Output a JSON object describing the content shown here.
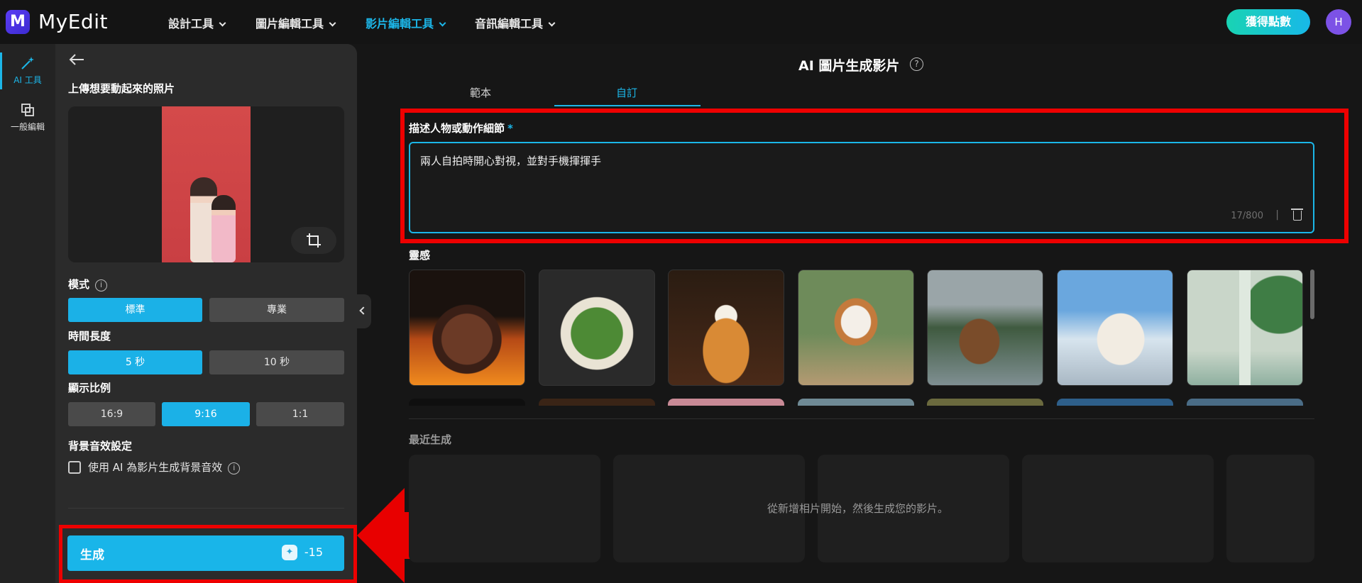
{
  "app": {
    "name": "MyEdit",
    "logo_letter": "M"
  },
  "nav": [
    {
      "label": "設計工具",
      "active": false
    },
    {
      "label": "圖片編輯工具",
      "active": false
    },
    {
      "label": "影片編輯工具",
      "active": true
    },
    {
      "label": "音訊編輯工具",
      "active": false
    }
  ],
  "header": {
    "points_button": "獲得點數",
    "avatar_initial": "H"
  },
  "rail": [
    {
      "label": "AI 工具",
      "icon": "magic-wand-icon",
      "active": true
    },
    {
      "label": "一般編輯",
      "icon": "layers-icon",
      "active": false
    }
  ],
  "panel": {
    "upload_title": "上傳想要動起來的照片",
    "mode": {
      "label": "模式",
      "options": [
        "標準",
        "專業"
      ],
      "selected": "標準"
    },
    "duration": {
      "label": "時間長度",
      "options": [
        "5 秒",
        "10 秒"
      ],
      "selected": "5 秒"
    },
    "ratio": {
      "label": "顯示比例",
      "options": [
        "16:9",
        "9:16",
        "1:1"
      ],
      "selected": "9:16"
    },
    "audio": {
      "label": "背景音效設定",
      "checkbox_label": "使用 AI 為影片生成背景音效",
      "checked": false
    },
    "generate": {
      "label": "生成",
      "cost": "-15"
    }
  },
  "main": {
    "title": "AI 圖片生成影片",
    "tabs": [
      {
        "label": "範本",
        "active": false
      },
      {
        "label": "自訂",
        "active": true
      }
    ],
    "description": {
      "label": "描述人物或動作細節",
      "required_mark": "*",
      "value": "兩人自拍時開心對視，並對手機揮揮手",
      "char_count": "17/800",
      "separator": "|"
    },
    "inspiration": {
      "label": "靈感",
      "items": [
        "grilled-steak",
        "salad-bowl",
        "pancake-stack",
        "running-dog",
        "capybara-hot-spring",
        "polar-bear-with-scarf",
        "skincare-products"
      ]
    },
    "recent": {
      "label": "最近生成",
      "empty_text": "從新增相片開始，然後生成您的影片。"
    }
  },
  "colors": {
    "accent": "#1bb6e8",
    "highlight": "#e00000",
    "background": "#161616",
    "panel": "#2b2b2b"
  }
}
